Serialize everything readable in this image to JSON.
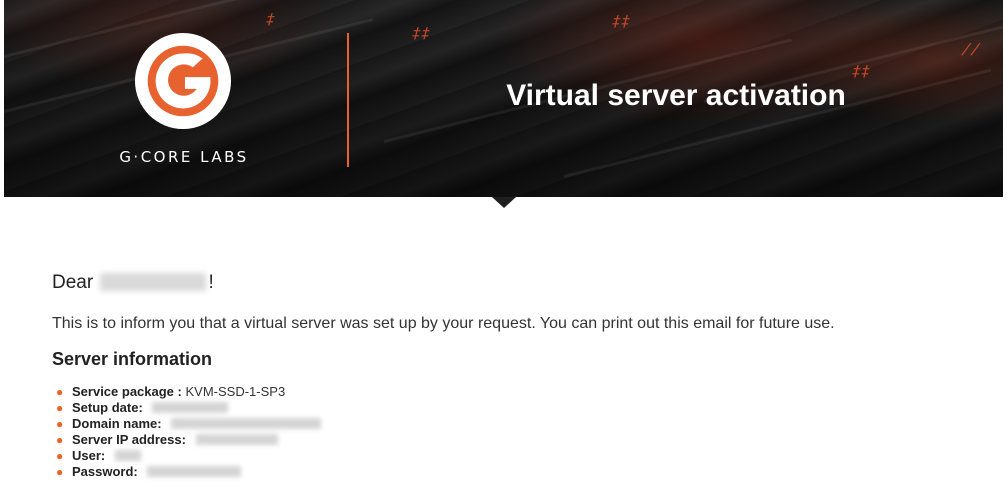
{
  "header": {
    "brand": "G·CORE LABS",
    "title": "Virtual server activation",
    "led_glyphs": [
      "‡",
      "‡‡",
      "‡‡",
      "//",
      "‡‡"
    ]
  },
  "body": {
    "greeting_prefix": "Dear",
    "greeting_suffix": "!",
    "intro": "This is to inform you that a virtual server was set up by your request. You can print out this email for future use.",
    "section_title": "Server information"
  },
  "server_info": [
    {
      "label": "Service package :",
      "value": "KVM-SSD-1-SP3"
    },
    {
      "label": "Setup date:",
      "value": ""
    },
    {
      "label": "Domain name:",
      "value": ""
    },
    {
      "label": "Server IP address:",
      "value": ""
    },
    {
      "label": "User:",
      "value": ""
    },
    {
      "label": "Password:",
      "value": ""
    }
  ],
  "colors": {
    "accent": "#e8622f",
    "banner_bg": "#1a1a1a",
    "title_text": "#ffffff"
  },
  "icons": {
    "logo": "g-core-logo-icon",
    "bullet": "bullet-icon"
  }
}
